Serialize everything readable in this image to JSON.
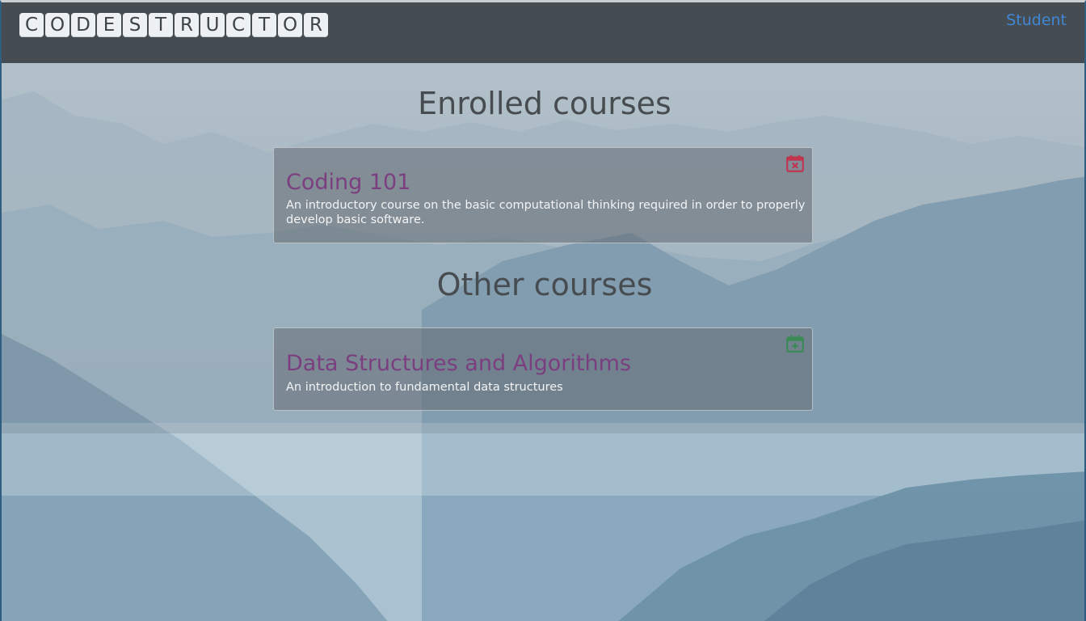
{
  "header": {
    "logo_letters": [
      "C",
      "O",
      "D",
      "E",
      "S",
      "T",
      "R",
      "U",
      "C",
      "T",
      "O",
      "R"
    ],
    "nav_user_label": "Student"
  },
  "enrolled": {
    "heading": "Enrolled courses",
    "courses": [
      {
        "title": "Coding 101",
        "description": "An introductory course on the basic computational thinking required in order to properly develop basic software.",
        "action_icon": "calendar-remove-icon",
        "action_color": "#c0354f"
      }
    ]
  },
  "other": {
    "heading": "Other courses",
    "courses": [
      {
        "title": "Data Structures and Algorithms",
        "description": "An introduction to fundamental data structures",
        "action_icon": "calendar-add-icon",
        "action_color": "#3a8a55"
      }
    ]
  },
  "colors": {
    "header_bg": "#464d52",
    "link": "#3f86d6",
    "course_title": "#7b3f80",
    "heading": "#474c50"
  }
}
